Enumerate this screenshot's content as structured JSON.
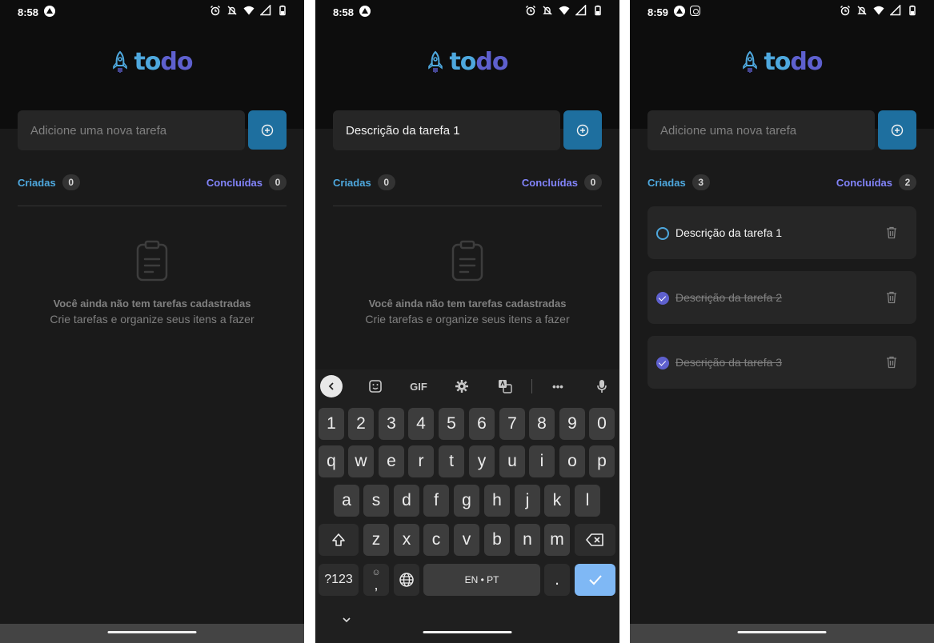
{
  "colors": {
    "background": "#1a1a1a",
    "header": "#0d0d0d",
    "blue": "#4ea8de",
    "blue_dark": "#1e6f9f",
    "purple": "#8284fa",
    "purple_dark": "#5e60ce",
    "surface": "#262626",
    "muted_text": "#808080"
  },
  "screens": [
    {
      "status_time": "8:58",
      "logo": {
        "text_a": "to",
        "text_b": "do"
      },
      "input": {
        "value": "",
        "placeholder": "Adicione uma nova tarefa"
      },
      "counters": {
        "created_label": "Criadas",
        "created_count": "0",
        "done_label": "Concluídas",
        "done_count": "0"
      },
      "empty": {
        "title": "Você ainda não tem tarefas cadastradas",
        "subtitle": "Crie tarefas e organize seus itens a fazer"
      }
    },
    {
      "status_time": "8:58",
      "logo": {
        "text_a": "to",
        "text_b": "do"
      },
      "input": {
        "value": "Descrição da tarefa 1",
        "placeholder": "Adicione uma nova tarefa"
      },
      "counters": {
        "created_label": "Criadas",
        "created_count": "0",
        "done_label": "Concluídas",
        "done_count": "0"
      },
      "empty": {
        "title": "Você ainda não tem tarefas cadastradas",
        "subtitle": "Crie tarefas e organize seus itens a fazer"
      },
      "keyboard": {
        "toolbar": {
          "gif": "GIF",
          "more": "•••"
        },
        "row_numbers": [
          "1",
          "2",
          "3",
          "4",
          "5",
          "6",
          "7",
          "8",
          "9",
          "0"
        ],
        "row_1": [
          "q",
          "w",
          "e",
          "r",
          "t",
          "y",
          "u",
          "i",
          "o",
          "p"
        ],
        "row_2": [
          "a",
          "s",
          "d",
          "f",
          "g",
          "h",
          "j",
          "k",
          "l"
        ],
        "row_3": [
          "z",
          "x",
          "c",
          "v",
          "b",
          "n",
          "m"
        ],
        "symbols_key": "?123",
        "comma_key": ",",
        "emoji_key": "☺",
        "space_label": "EN • PT",
        "period_key": "."
      }
    },
    {
      "status_time": "8:59",
      "logo": {
        "text_a": "to",
        "text_b": "do"
      },
      "input": {
        "value": "",
        "placeholder": "Adicione uma nova tarefa"
      },
      "counters": {
        "created_label": "Criadas",
        "created_count": "3",
        "done_label": "Concluídas",
        "done_count": "2"
      },
      "tasks": [
        {
          "text": "Descrição da tarefa 1",
          "done": false
        },
        {
          "text": "Descrição da tarefa 2",
          "done": true
        },
        {
          "text": "Descrição da tarefa 3",
          "done": true
        }
      ]
    }
  ]
}
